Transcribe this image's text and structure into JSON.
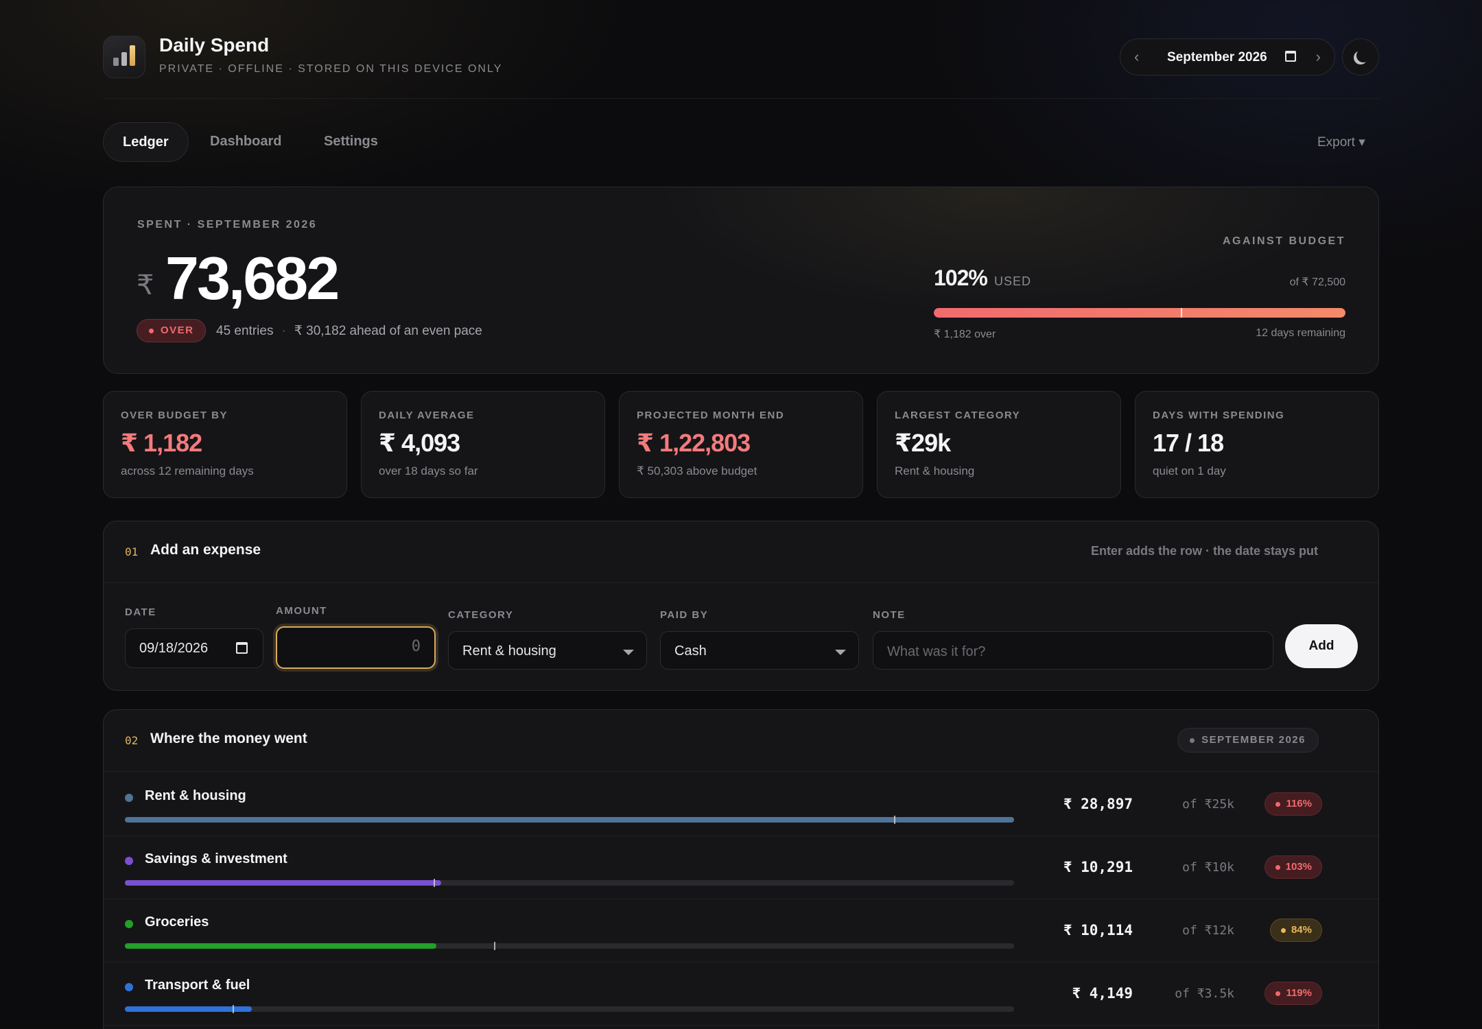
{
  "app": {
    "title": "Daily Spend",
    "subtitle": "PRIVATE · OFFLINE · STORED ON THIS DEVICE ONLY",
    "logo_icon": "bar-chart-icon"
  },
  "header": {
    "month_label": "September  2026",
    "prev_icon": "chevron-left-icon",
    "next_icon": "chevron-right-icon",
    "calendar_icon": "calendar-icon",
    "theme_icon": "moon-icon",
    "prev_glyph": "‹",
    "next_glyph": "›"
  },
  "tabs": [
    {
      "label": "Ledger",
      "active": true
    },
    {
      "label": "Dashboard",
      "active": false
    },
    {
      "label": "Settings",
      "active": false
    }
  ],
  "export_label": "Export ▾",
  "hero": {
    "kicker": "SPENT · SEPTEMBER 2026",
    "currency": "₹",
    "amount": "73,682",
    "status_badge": "OVER",
    "entries": "45 entries",
    "separator": "·",
    "pace": "₹ 30,182 ahead of an even pace",
    "budget_kicker": "AGAINST BUDGET",
    "budget_pct": "102%",
    "budget_used": "USED",
    "budget_of": "of ₹ 72,500",
    "budget_fraction": 1.0,
    "pace_fraction": 0.6,
    "budget_over": "₹ 1,182 over",
    "days_remaining": "12 days remaining",
    "accent_colors": [
      "#f26a6e",
      "#f38a6a"
    ]
  },
  "stats": [
    {
      "label": "OVER BUDGET BY",
      "value": "₹ 1,182",
      "sub": "across 12 remaining days",
      "red": true
    },
    {
      "label": "DAILY AVERAGE",
      "value": "₹ 4,093",
      "sub": "over 18 days so far",
      "red": false
    },
    {
      "label": "PROJECTED MONTH END",
      "value": "₹ 1,22,803",
      "sub": "₹ 50,303 above budget",
      "red": true
    },
    {
      "label": "LARGEST CATEGORY",
      "value": "₹29k",
      "sub": "Rent & housing",
      "red": false
    },
    {
      "label": "DAYS WITH SPENDING",
      "value": "17 / 18",
      "sub": "quiet on 1 day",
      "red": false
    }
  ],
  "add_expense": {
    "number": "01",
    "title": "Add an expense",
    "hint": "Enter adds the row · the date stays put",
    "date_label": "DATE",
    "date_value": "09/18/2026",
    "amount_label": "AMOUNT",
    "amount_placeholder": "0",
    "category_label": "CATEGORY",
    "category_value": "Rent & housing",
    "paid_by_label": "PAID BY",
    "paid_by_value": "Cash",
    "note_label": "NOTE",
    "note_placeholder": "What was it for?",
    "add_button": "Add"
  },
  "categories": {
    "number": "02",
    "title": "Where the money went",
    "month_tag": "SEPTEMBER 2026",
    "rows": [
      {
        "name": "Rent & housing",
        "amount": "₹ 28,897",
        "of": "of ₹25k",
        "pct": "116%",
        "status": "over",
        "color": "#4f7399",
        "fill": 1.0,
        "marker": 0.865
      },
      {
        "name": "Savings & investment",
        "amount": "₹ 10,291",
        "of": "of ₹10k",
        "pct": "103%",
        "status": "over",
        "color": "#7a4fd0",
        "fill": 0.356,
        "marker": 0.347
      },
      {
        "name": "Groceries",
        "amount": "₹ 10,114",
        "of": "of ₹12k",
        "pct": "84%",
        "status": "warn",
        "color": "#22a02a",
        "fill": 0.35,
        "marker": 0.415
      },
      {
        "name": "Transport & fuel",
        "amount": "₹ 4,149",
        "of": "of ₹3.5k",
        "pct": "119%",
        "status": "over",
        "color": "#2f72d8",
        "fill": 0.143,
        "marker": 0.121
      }
    ]
  }
}
